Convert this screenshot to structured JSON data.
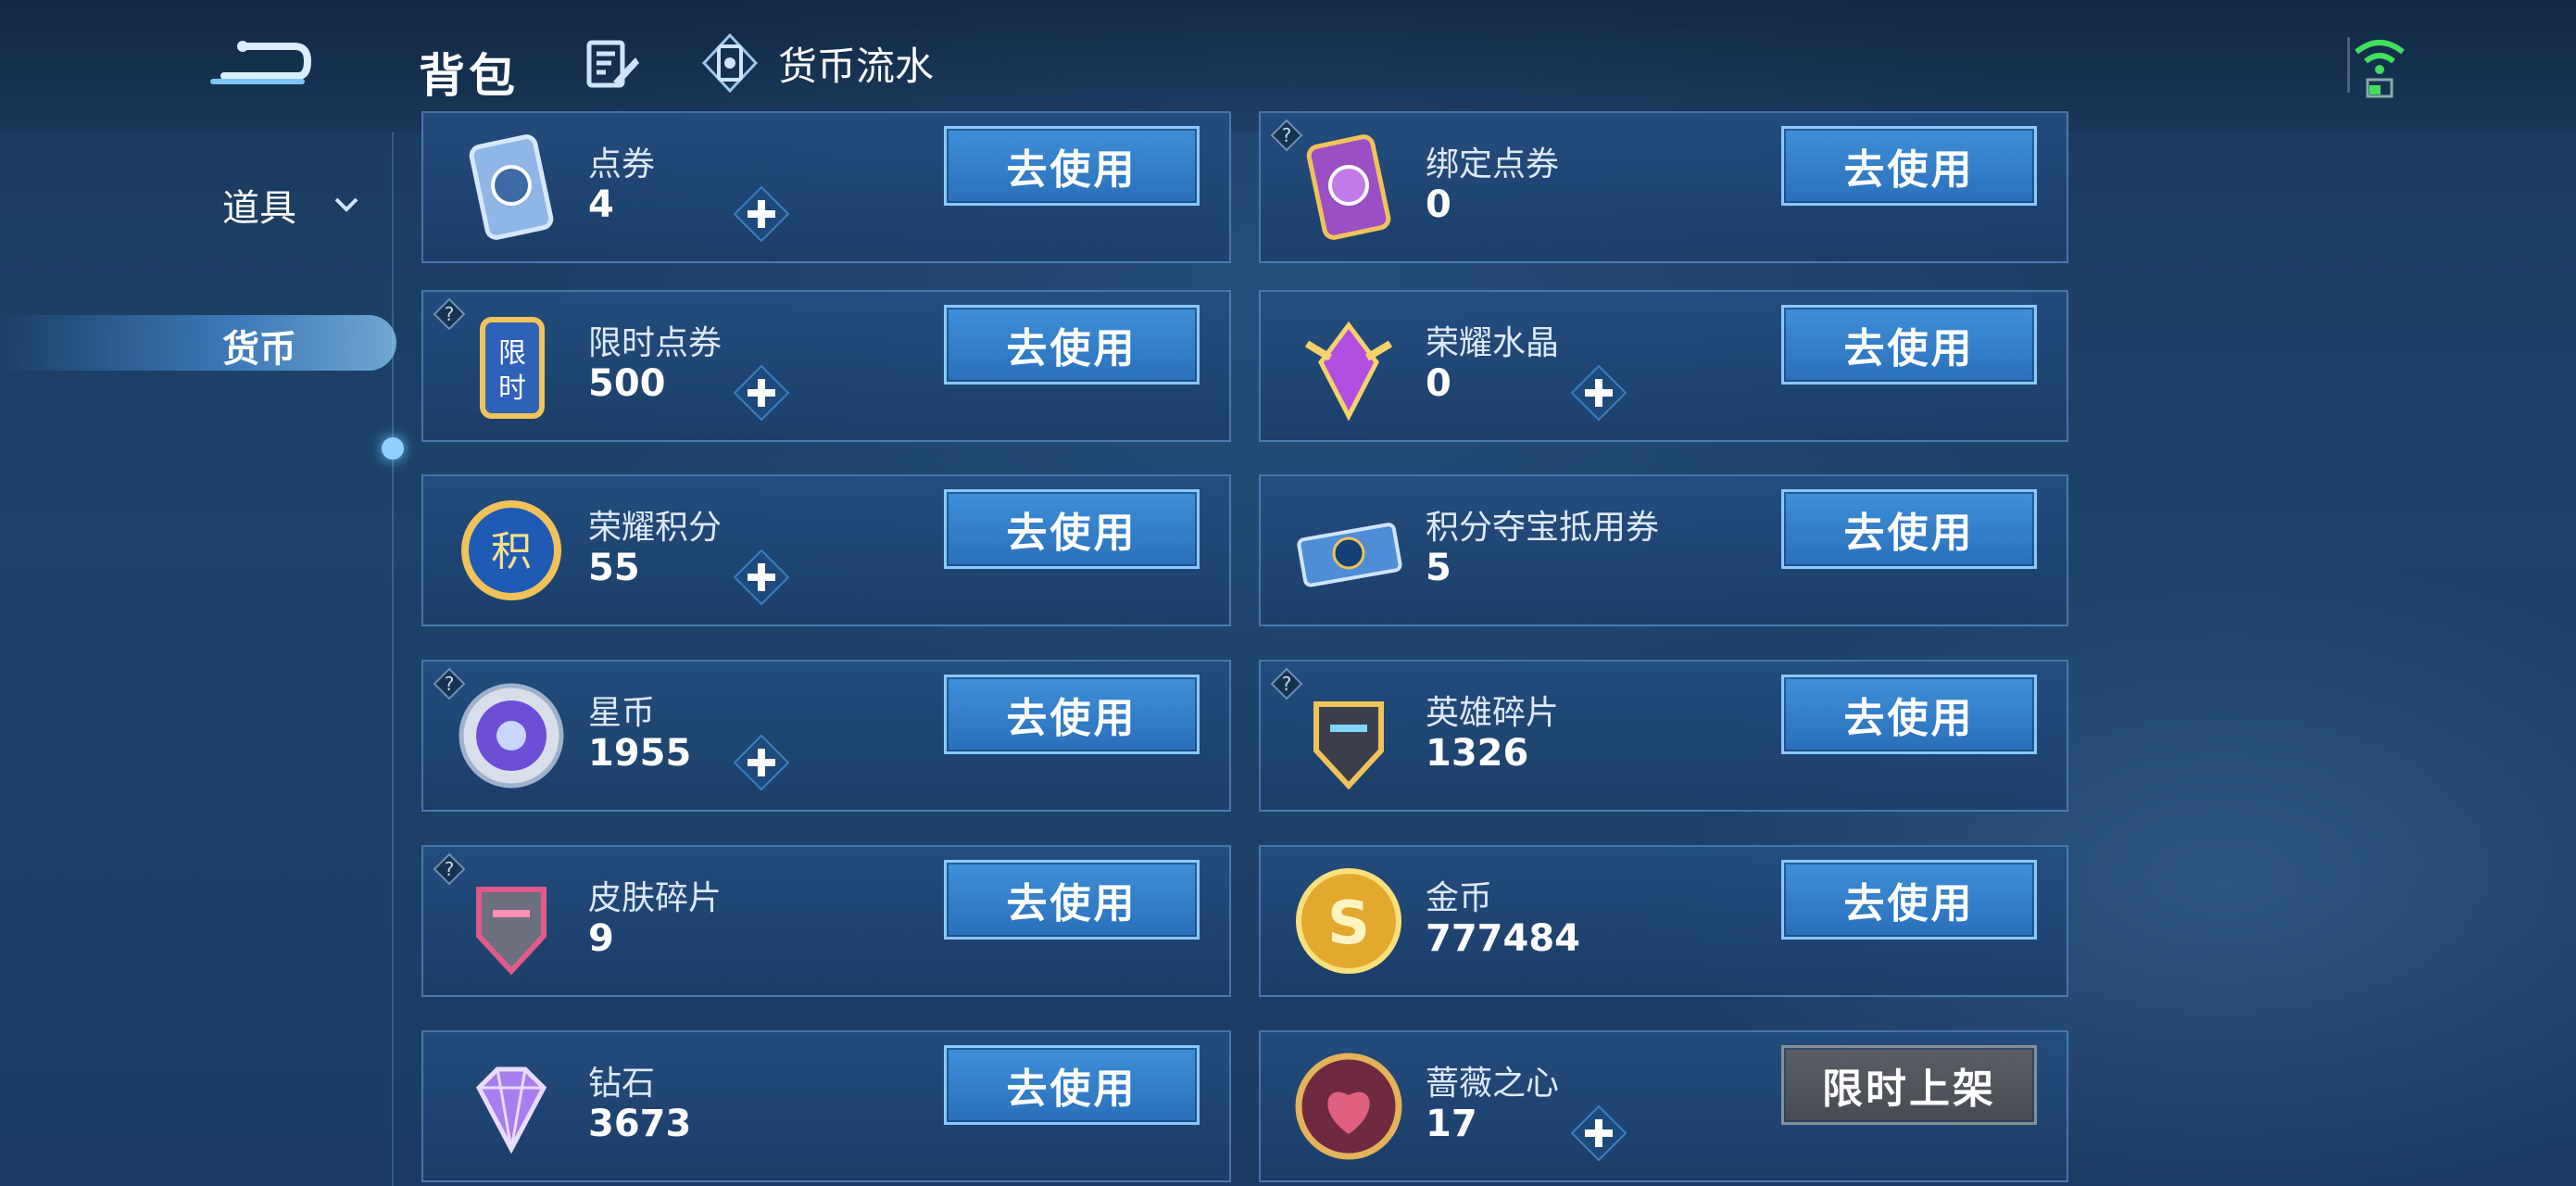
{
  "header": {
    "title": "背包",
    "flow_label": "货币流水",
    "icons": [
      "back-icon",
      "edit-icon",
      "currency-flow-icon",
      "wifi-icon"
    ]
  },
  "sidebar": {
    "items": [
      {
        "label": "道具",
        "expanded": false
      },
      {
        "label": "货币",
        "selected": true
      }
    ]
  },
  "colors": {
    "button_blue": "#2f7bc6",
    "button_gray": "#4f545a",
    "background": "#1d4369"
  },
  "cards": [
    {
      "name": "点券",
      "count": "4",
      "plus": true,
      "help": false,
      "button": "去使用",
      "icon": "coupon-icon"
    },
    {
      "name": "绑定点券",
      "count": "0",
      "plus": false,
      "help": true,
      "button": "去使用",
      "icon": "bound-coupon-icon"
    },
    {
      "name": "限时点券",
      "count": "500",
      "plus": true,
      "help": true,
      "button": "去使用",
      "icon": "timed-coupon-icon"
    },
    {
      "name": "荣耀水晶",
      "count": "0",
      "plus": true,
      "help": false,
      "button": "去使用",
      "icon": "glory-crystal-icon"
    },
    {
      "name": "荣耀积分",
      "count": "55",
      "plus": true,
      "help": false,
      "button": "去使用",
      "icon": "glory-points-icon"
    },
    {
      "name": "积分夺宝抵用券",
      "count": "5",
      "plus": false,
      "help": false,
      "button": "去使用",
      "icon": "lottery-voucher-icon"
    },
    {
      "name": "星币",
      "count": "1955",
      "plus": true,
      "help": true,
      "button": "去使用",
      "icon": "star-coin-icon"
    },
    {
      "name": "英雄碎片",
      "count": "1326",
      "plus": false,
      "help": true,
      "button": "去使用",
      "icon": "hero-fragment-icon"
    },
    {
      "name": "皮肤碎片",
      "count": "9",
      "plus": false,
      "help": true,
      "button": "去使用",
      "icon": "skin-fragment-icon"
    },
    {
      "name": "金币",
      "count": "777484",
      "plus": false,
      "help": false,
      "button": "去使用",
      "icon": "gold-coin-icon"
    },
    {
      "name": "钻石",
      "count": "3673",
      "plus": false,
      "help": false,
      "button": "去使用",
      "icon": "diamond-icon"
    },
    {
      "name": "蔷薇之心",
      "count": "17",
      "plus": true,
      "help": false,
      "button": "限时上架",
      "icon": "rose-heart-icon",
      "button_style": "gray"
    }
  ]
}
